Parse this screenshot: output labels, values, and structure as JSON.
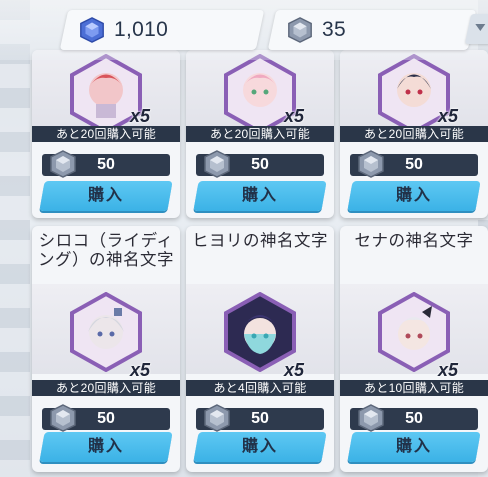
{
  "currency": {
    "pyroxene": {
      "icon": "pyroxene-icon",
      "value": "1,010"
    },
    "eligma": {
      "icon": "eligma-icon",
      "value": "35"
    }
  },
  "colors": {
    "accent": "#3bb2e6",
    "dark": "#2a3648",
    "hex_frame": "#8a5fb5"
  },
  "top_row": [
    {
      "quantity": "x5",
      "limit": "あと20回購入可能",
      "price": "50",
      "buy_label": "購入"
    },
    {
      "quantity": "x5",
      "limit": "あと20回購入可能",
      "price": "50",
      "buy_label": "購入"
    },
    {
      "quantity": "x5",
      "limit": "あと20回購入可能",
      "price": "50",
      "buy_label": "購入"
    }
  ],
  "bottom_row": [
    {
      "name": "シロコ（ライディング）の神名文字",
      "quantity": "x5",
      "limit": "あと20回購入可能",
      "price": "50",
      "buy_label": "購入"
    },
    {
      "name": "ヒヨリの神名文字",
      "quantity": "x5",
      "limit": "あと4回購入可能",
      "price": "50",
      "buy_label": "購入"
    },
    {
      "name": "セナの神名文字",
      "quantity": "x5",
      "limit": "あと10回購入可能",
      "price": "50",
      "buy_label": "購入"
    }
  ]
}
